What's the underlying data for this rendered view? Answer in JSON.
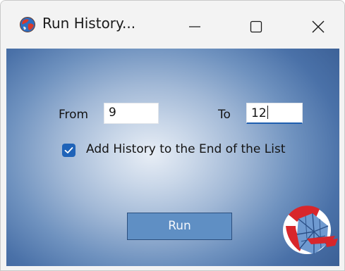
{
  "window": {
    "title": "Run History..."
  },
  "form": {
    "from_label": "From",
    "from_value": "9",
    "to_label": "To",
    "to_value": "12",
    "checkbox_label": "Add History to the End of the List",
    "checkbox_checked": true,
    "run_label": "Run"
  },
  "icons": {
    "app": "app-globe-icon",
    "minimize": "minimize-icon",
    "maximize": "maximize-icon",
    "close": "close-icon",
    "check": "checkmark-icon",
    "logo": "brand-logo-icon"
  },
  "colors": {
    "accent": "#1f63b8",
    "button": "#5f8fc4",
    "background_dark": "#3b5f95"
  }
}
